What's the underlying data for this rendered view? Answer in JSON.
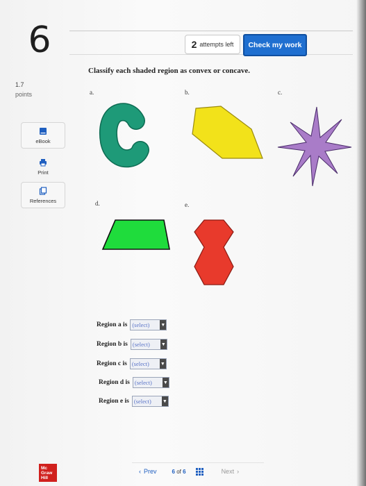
{
  "question": {
    "number": "6",
    "points_value": "1.7",
    "points_label": "points"
  },
  "header": {
    "attempts_count": "2",
    "attempts_label": "attempts left",
    "check_button": "Check my work"
  },
  "sidebar": {
    "items": [
      {
        "label": "eBook",
        "icon": "book-icon"
      },
      {
        "label": "Print",
        "icon": "printer-icon"
      },
      {
        "label": "References",
        "icon": "references-icon"
      }
    ]
  },
  "prompt": "Classify each shaded region as convex or concave.",
  "shapes": [
    {
      "label": "a.",
      "color": "#1e9a78",
      "icon": "c-shape"
    },
    {
      "label": "b.",
      "color": "#f2e21a",
      "icon": "hexagon"
    },
    {
      "label": "c.",
      "color": "#a97cc8",
      "icon": "star"
    },
    {
      "label": "d.",
      "color": "#1fdc3c",
      "icon": "trapezoid"
    },
    {
      "label": "e.",
      "color": "#e83a2c",
      "icon": "hourglass"
    }
  ],
  "answers": [
    {
      "label": "Region a is",
      "value": "(select)"
    },
    {
      "label": "Region b is",
      "value": "(select)"
    },
    {
      "label": "Region c is",
      "value": "(select)"
    },
    {
      "label": "Region d is",
      "value": "(select)"
    },
    {
      "label": "Region e is",
      "value": "(select)"
    }
  ],
  "footer": {
    "logo_lines": [
      "Mc",
      "Graw",
      "Hill"
    ],
    "prev_label": "Prev",
    "page_current": "6",
    "page_of": "of",
    "page_total": "6",
    "next_label": "Next"
  }
}
